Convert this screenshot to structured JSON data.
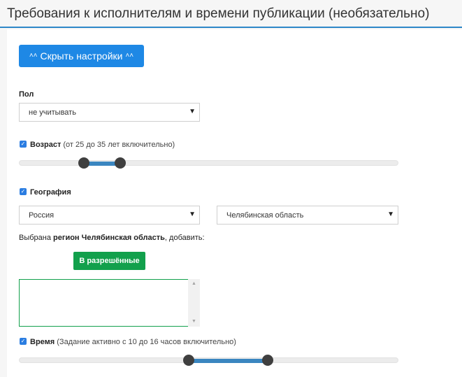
{
  "header": {
    "title": "Требования к исполнителям и времени публикации (необязательно)"
  },
  "toggle_button": {
    "label": "Скрыть настройки",
    "icon": "double-chevron-up-icon"
  },
  "gender": {
    "label": "Пол",
    "value": "не учитывать"
  },
  "age": {
    "checked": true,
    "label": "Возраст",
    "hint": "(от 25 до 35 лет включительно)",
    "min": 25,
    "max": 35
  },
  "geo": {
    "checked": true,
    "label": "География",
    "country": "Россия",
    "region": "Челябинская область"
  },
  "selection": {
    "prefix": "Выбрана ",
    "strong": "регион Челябинская область",
    "suffix": ", добавить:"
  },
  "allow_button": {
    "label": "В разрешённые"
  },
  "time": {
    "checked": true,
    "label": "Время",
    "hint": "(Задание активно с 10 до 16 часов включительно)",
    "from": 10,
    "to": 16
  },
  "colors": {
    "accent": "#1e88e5",
    "header_rule": "#2e87c8",
    "green": "#12a04c",
    "slider_range": "#3a86c0"
  }
}
